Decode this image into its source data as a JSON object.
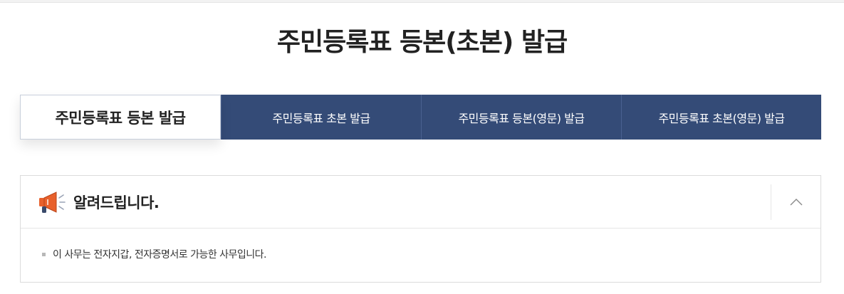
{
  "page": {
    "title": "주민등록표 등본(초본) 발급"
  },
  "tabs": [
    {
      "label": "주민등록표 등본 발급",
      "active": true
    },
    {
      "label": "주민등록표 초본 발급",
      "active": false
    },
    {
      "label": "주민등록표 등본(영문) 발급",
      "active": false
    },
    {
      "label": "주민등록표 초본(영문) 발급",
      "active": false
    }
  ],
  "notice": {
    "icon": "megaphone-icon",
    "title": "알려드립니다.",
    "toggle_icon": "chevron-up-icon",
    "items": [
      "이 사무는 전자지갑, 전자증명서로 가능한 사무입니다."
    ]
  },
  "colors": {
    "tab_background": "#344b77",
    "accent_orange": "#e8612c",
    "text": "#222222"
  }
}
